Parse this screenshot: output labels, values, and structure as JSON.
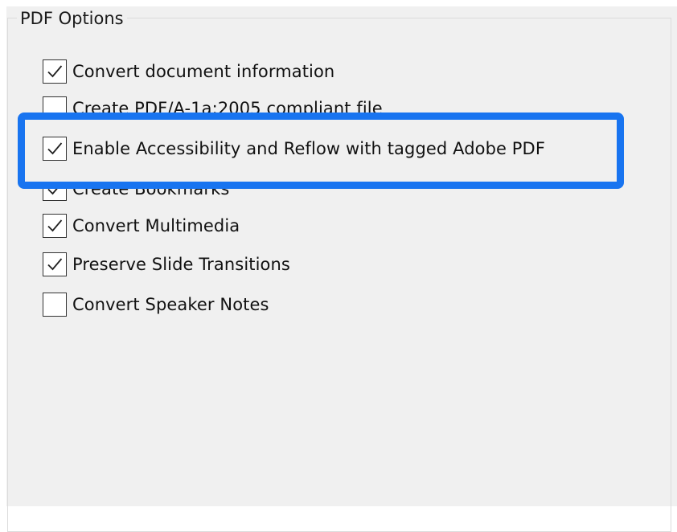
{
  "group": {
    "title": "PDF Options"
  },
  "accent_color": "#1874f0",
  "options": [
    {
      "label": "Convert document information",
      "checked": true
    },
    {
      "label": "Create PDF/A-1a:2005 compliant file",
      "checked": false
    },
    {
      "label": "Enable Accessibility and Reflow with tagged Adobe PDF",
      "checked": true
    },
    {
      "label": "Create Bookmarks",
      "checked": true
    },
    {
      "label": "Convert Multimedia",
      "checked": true
    },
    {
      "label": "Preserve Slide Transitions",
      "checked": true
    },
    {
      "label": "Convert Speaker Notes",
      "checked": false
    }
  ]
}
